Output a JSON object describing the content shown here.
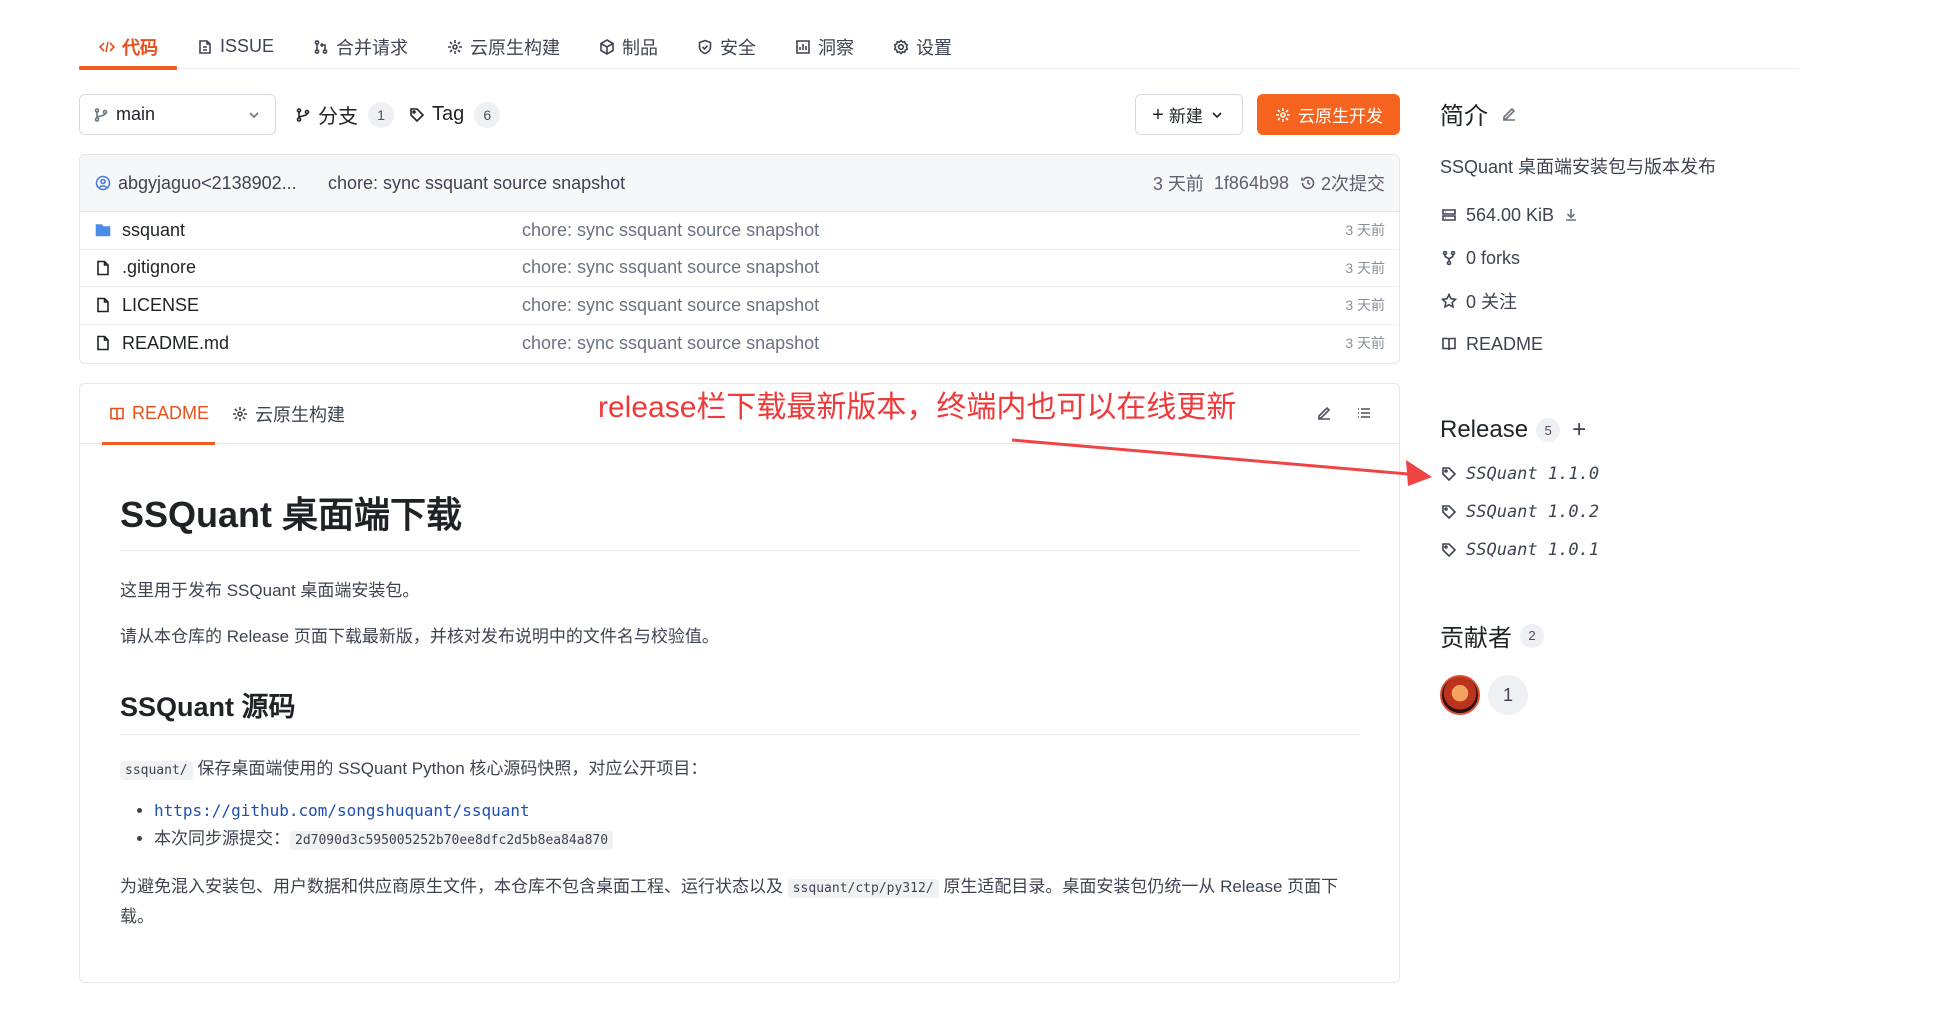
{
  "nav": {
    "tabs": [
      {
        "label": "代码",
        "icon": "code-icon",
        "active": true
      },
      {
        "label": "ISSUE",
        "icon": "issue-icon"
      },
      {
        "label": "合并请求",
        "icon": "pull-request-icon"
      },
      {
        "label": "云原生构建",
        "icon": "build-icon"
      },
      {
        "label": "制品",
        "icon": "package-icon"
      },
      {
        "label": "安全",
        "icon": "shield-icon"
      },
      {
        "label": "洞察",
        "icon": "chart-icon"
      },
      {
        "label": "设置",
        "icon": "gear-icon"
      }
    ]
  },
  "toolbar": {
    "branch": "main",
    "branches_label": "分支",
    "branches_count": "1",
    "tags_label": "Tag",
    "tags_count": "6",
    "new_label": "新建",
    "cloud_dev_label": "云原生开发"
  },
  "commit": {
    "author": "abgyjaguo<2138902...",
    "message": "chore: sync ssquant source snapshot",
    "time": "3 天前",
    "hash": "1f864b98",
    "commits": "2次提交"
  },
  "files": [
    {
      "name": "ssquant",
      "type": "folder",
      "message": "chore: sync ssquant source snapshot",
      "time": "3 天前"
    },
    {
      "name": ".gitignore",
      "type": "file",
      "message": "chore: sync ssquant source snapshot",
      "time": "3 天前"
    },
    {
      "name": "LICENSE",
      "type": "file",
      "message": "chore: sync ssquant source snapshot",
      "time": "3 天前"
    },
    {
      "name": "README.md",
      "type": "file",
      "message": "chore: sync ssquant source snapshot",
      "time": "3 天前"
    }
  ],
  "readme": {
    "tab_readme": "README",
    "tab_build": "云原生构建",
    "h1": "SSQuant 桌面端下载",
    "p1": "这里用于发布 SSQuant 桌面端安装包。",
    "p2": "请从本仓库的 Release 页面下载最新版，并核对发布说明中的文件名与校验值。",
    "h2": "SSQuant 源码",
    "p3_code": "ssquant/",
    "p3_text": " 保存桌面端使用的 SSQuant Python 核心源码快照，对应公开项目：",
    "link": "https://github.com/songshuquant/ssquant",
    "sync_label": "本次同步源提交：",
    "sync_hash": "2d7090d3c595005252b70ee8dfc2d5b8ea84a870",
    "p4_a": "为避免混入安装包、用户数据和供应商原生文件，本仓库不包含桌面工程、运行状态以及 ",
    "p4_code": "ssquant/ctp/py312/",
    "p4_b": " 原生适配目录。桌面安装包仍统一从 Release 页面下载。"
  },
  "annotation": "release栏下载最新版本，终端内也可以在线更新",
  "sidebar": {
    "intro_title": "简介",
    "description": "SSQuant 桌面端安装包与版本发布",
    "size": "564.00 KiB",
    "forks": "0 forks",
    "stars": "0 关注",
    "readme": "README",
    "release_title": "Release",
    "release_count": "5",
    "releases": [
      "SSQuant 1.1.0",
      "SSQuant 1.0.2",
      "SSQuant 1.0.1"
    ],
    "contributors_title": "贡献者",
    "contributors_count": "2",
    "more_contributors": "1"
  },
  "colors": {
    "accent": "#f5631e",
    "annotation": "#ee3a3a",
    "link": "#1e4fb4"
  }
}
